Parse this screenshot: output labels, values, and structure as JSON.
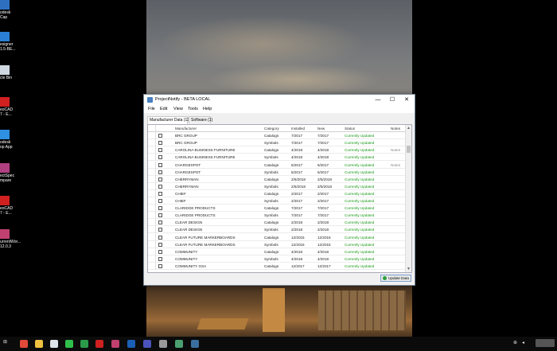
{
  "window": {
    "title": "ProjectNotify - BETA LOCAL",
    "minimize": "—",
    "maximize": "☐",
    "close": "✕"
  },
  "menu": [
    "File",
    "Edit",
    "View",
    "Tools",
    "Help"
  ],
  "tabs": [
    "Manufacturer Data (13)",
    "Software (1)"
  ],
  "columns": [
    "Manufacturer",
    "Category",
    "Installed",
    "New",
    "Status",
    "Notes"
  ],
  "rows": [
    [
      "BRC GROUP",
      "Catalogs",
      "7/2017",
      "7/2017",
      "Currently Updated",
      ""
    ],
    [
      "BRC GROUP",
      "Symbols",
      "7/2017",
      "7/2017",
      "Currently Updated",
      ""
    ],
    [
      "CAROLINA BUSINESS FURNITURE",
      "Catalogs",
      "4/2018",
      "4/2018",
      "Currently Updated",
      "Notes"
    ],
    [
      "CAROLINA BUSINESS FURNITURE",
      "Symbols",
      "4/2018",
      "4/2018",
      "Currently Updated",
      ""
    ],
    [
      "CHARGESPOT",
      "Catalogs",
      "5/2017",
      "5/2017",
      "Currently Updated",
      "Notes"
    ],
    [
      "CHARGESPOT",
      "Symbols",
      "5/2017",
      "5/2017",
      "Currently Updated",
      ""
    ],
    [
      "CHERRYMAN",
      "Catalogs",
      "2/5/2018",
      "2/5/2018",
      "Currently Updated",
      ""
    ],
    [
      "CHERRYMAN",
      "Symbols",
      "2/5/2018",
      "2/5/2018",
      "Currently Updated",
      ""
    ],
    [
      "CHIEF",
      "Catalogs",
      "2/2017",
      "2/2017",
      "Currently Updated",
      ""
    ],
    [
      "CHIEF",
      "Symbols",
      "2/2017",
      "2/2017",
      "Currently Updated",
      ""
    ],
    [
      "CLARIDGE PRODUCTS",
      "Catalogs",
      "7/2017",
      "7/2017",
      "Currently Updated",
      ""
    ],
    [
      "CLARIDGE PRODUCTS",
      "Symbols",
      "7/2017",
      "7/2017",
      "Currently Updated",
      ""
    ],
    [
      "CLEAR DESIGN",
      "Catalogs",
      "2/2018",
      "2/2018",
      "Currently Updated",
      ""
    ],
    [
      "CLEAR DESIGN",
      "Symbols",
      "2/2018",
      "2/2018",
      "Currently Updated",
      ""
    ],
    [
      "CLEAR FUTURE MARKERBOARDS",
      "Catalogs",
      "12/2015",
      "12/2015",
      "Currently Updated",
      ""
    ],
    [
      "CLEAR FUTURE MARKERBOARDS",
      "Symbols",
      "12/2015",
      "12/2015",
      "Currently Updated",
      ""
    ],
    [
      "COMMUNITY",
      "Catalogs",
      "4/2018",
      "4/2018",
      "Currently Updated",
      ""
    ],
    [
      "COMMUNITY",
      "Symbols",
      "4/2018",
      "4/2018",
      "Currently Updated",
      ""
    ],
    [
      "COMMUNITY GSA",
      "Catalogs",
      "12/2017",
      "12/2017",
      "Currently Updated",
      ""
    ]
  ],
  "update_button": "Update Data",
  "desktop_icons": [
    {
      "label": "odesk\nCap",
      "color": "#2f6fc0",
      "icon": "autodesk-icon"
    },
    {
      "label": "esigner\n1.5-BE...",
      "color": "#2a7fd4",
      "icon": "designer-icon"
    },
    {
      "label": "cle Bin",
      "color": "#cfd8e0",
      "icon": "recycle-bin-icon"
    },
    {
      "label": "eoCAD\n7 - E...",
      "color": "#d02020",
      "icon": "autocad-icon"
    },
    {
      "label": "odesk\nop App",
      "color": "#2f8fe0",
      "icon": "autodesk-app-icon"
    },
    {
      "label": "ectSpec\nmpare",
      "color": "#b04080",
      "icon": "projectspec-icon"
    },
    {
      "label": "eoCAD\n7 - E...",
      "color": "#d02020",
      "icon": "autocad-icon"
    },
    {
      "label": "urrentWor...\n12.0.3",
      "color": "#c04070",
      "icon": "currentworks-icon"
    }
  ],
  "taskbar_icons": [
    {
      "name": "chrome-icon",
      "color": "#e04a3a"
    },
    {
      "name": "file-explorer-icon",
      "color": "#f0c040"
    },
    {
      "name": "notepad-icon",
      "color": "#dde4ea"
    },
    {
      "name": "whatsapp-icon",
      "color": "#2fbf4a"
    },
    {
      "name": "hangouts-icon",
      "color": "#2a9a4a"
    },
    {
      "name": "autocad-icon",
      "color": "#d02020"
    },
    {
      "name": "projectspec-icon",
      "color": "#c04070"
    },
    {
      "name": "outlook-icon",
      "color": "#1a5fb4"
    },
    {
      "name": "teams-icon",
      "color": "#4b53bc"
    },
    {
      "name": "photos-icon",
      "color": "#9a9a9a"
    },
    {
      "name": "projectnotify-icon",
      "color": "#4aa070"
    },
    {
      "name": "indesign-icon",
      "color": "#3a6fa0"
    }
  ]
}
